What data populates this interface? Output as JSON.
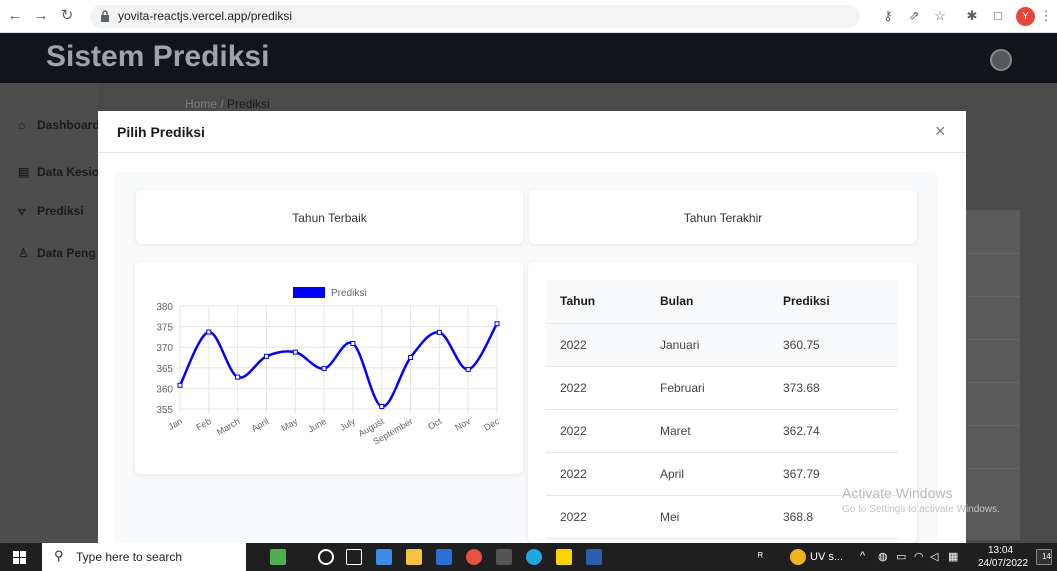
{
  "browser": {
    "url": "yovita-reactjs.vercel.app/prediksi",
    "profile_initial": "Y"
  },
  "app": {
    "title": "Sistem Prediksi"
  },
  "breadcrumb": {
    "home": "Home",
    "separator": "/",
    "current": "Prediksi"
  },
  "sidebar": {
    "items": [
      {
        "label": "Dashboard",
        "icon": "home-icon"
      },
      {
        "label": "Data Kesio",
        "icon": "document-icon"
      },
      {
        "label": "Prediksi",
        "icon": "chart-icon"
      },
      {
        "label": "Data Peng",
        "icon": "user-icon"
      }
    ]
  },
  "modal": {
    "title": "Pilih Prediksi",
    "close_label": "×",
    "best_year_label": "Tahun Terbaik",
    "last_year_label": "Tahun Terakhir"
  },
  "table": {
    "headers": [
      "Tahun",
      "Bulan",
      "Prediksi"
    ],
    "rows": [
      [
        "2022",
        "Januari",
        "360.75"
      ],
      [
        "2022",
        "Februari",
        "373.68"
      ],
      [
        "2022",
        "Maret",
        "362.74"
      ],
      [
        "2022",
        "April",
        "367.79"
      ],
      [
        "2022",
        "Mei",
        "368.8"
      ]
    ]
  },
  "chart_data": {
    "type": "line",
    "categories": [
      "Jan",
      "Feb",
      "March",
      "April",
      "May",
      "June",
      "July",
      "August",
      "September",
      "Oct",
      "Nov",
      "Dec"
    ],
    "series": [
      {
        "name": "Prediksi",
        "values": [
          360.75,
          373.68,
          362.74,
          367.79,
          368.8,
          364.8,
          370.9,
          355.6,
          367.5,
          373.6,
          364.6,
          375.7
        ]
      }
    ],
    "yticks": [
      355,
      360,
      365,
      370,
      375,
      380
    ],
    "ylim": [
      355,
      380
    ],
    "color": "#0000ff",
    "grid": true,
    "legend": "top"
  },
  "watermark": {
    "line1": "Activate Windows",
    "line2": "Go to Settings to activate Windows."
  },
  "taskbar": {
    "search_placeholder": "Type here to search",
    "app_label": "UV s...",
    "time": "13:04",
    "date": "24/07/2022",
    "notif_count": "14"
  }
}
